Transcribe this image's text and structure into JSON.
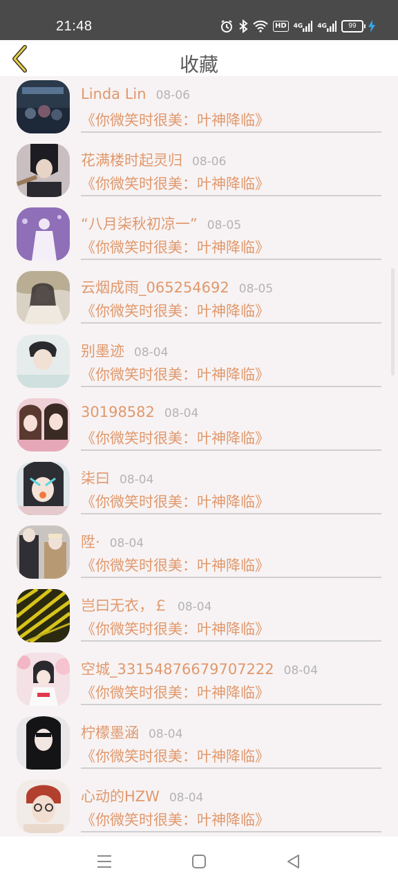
{
  "status_bar": {
    "time": "21:48",
    "hd_label": "HD",
    "net_label_1": "4G",
    "net_label_2": "4G",
    "battery_level": "99"
  },
  "header": {
    "title": "收藏"
  },
  "items": [
    {
      "name": "Linda Lin",
      "date": "08-06",
      "book": "《你微笑时很美：叶神降临》"
    },
    {
      "name": "花满楼时起灵归",
      "date": "08-06",
      "book": "《你微笑时很美：叶神降临》"
    },
    {
      "name": "“八月柒秋初凉一”",
      "date": "08-05",
      "book": "《你微笑时很美：叶神降临》"
    },
    {
      "name": "云烟成雨_065254692",
      "date": "08-05",
      "book": "《你微笑时很美：叶神降临》"
    },
    {
      "name": "别墨迹",
      "date": "08-04",
      "book": "《你微笑时很美：叶神降临》"
    },
    {
      "name": "30198582",
      "date": "08-04",
      "book": "《你微笑时很美：叶神降临》"
    },
    {
      "name": "柒曰",
      "date": "08-04",
      "book": "《你微笑时很美：叶神降临》"
    },
    {
      "name": "陞·",
      "date": "08-04",
      "book": "《你微笑时很美：叶神降临》"
    },
    {
      "name": "岂曰无衣，￡",
      "date": "08-04",
      "book": "《你微笑时很美：叶神降临》"
    },
    {
      "name": "空城_33154876679707222",
      "date": "08-04",
      "book": "《你微笑时很美：叶神降临》"
    },
    {
      "name": "柠檬墨涵",
      "date": "08-04",
      "book": "《你微笑时很美：叶神降临》"
    },
    {
      "name": "心动的HZW",
      "date": "08-04",
      "book": "《你微笑时很美：叶神降临》"
    }
  ],
  "colors": {
    "accent": "#e0986c",
    "date": "#b3b3b3",
    "status_bar": "#4a4a4a",
    "page_bg": "#f7f3f4"
  }
}
